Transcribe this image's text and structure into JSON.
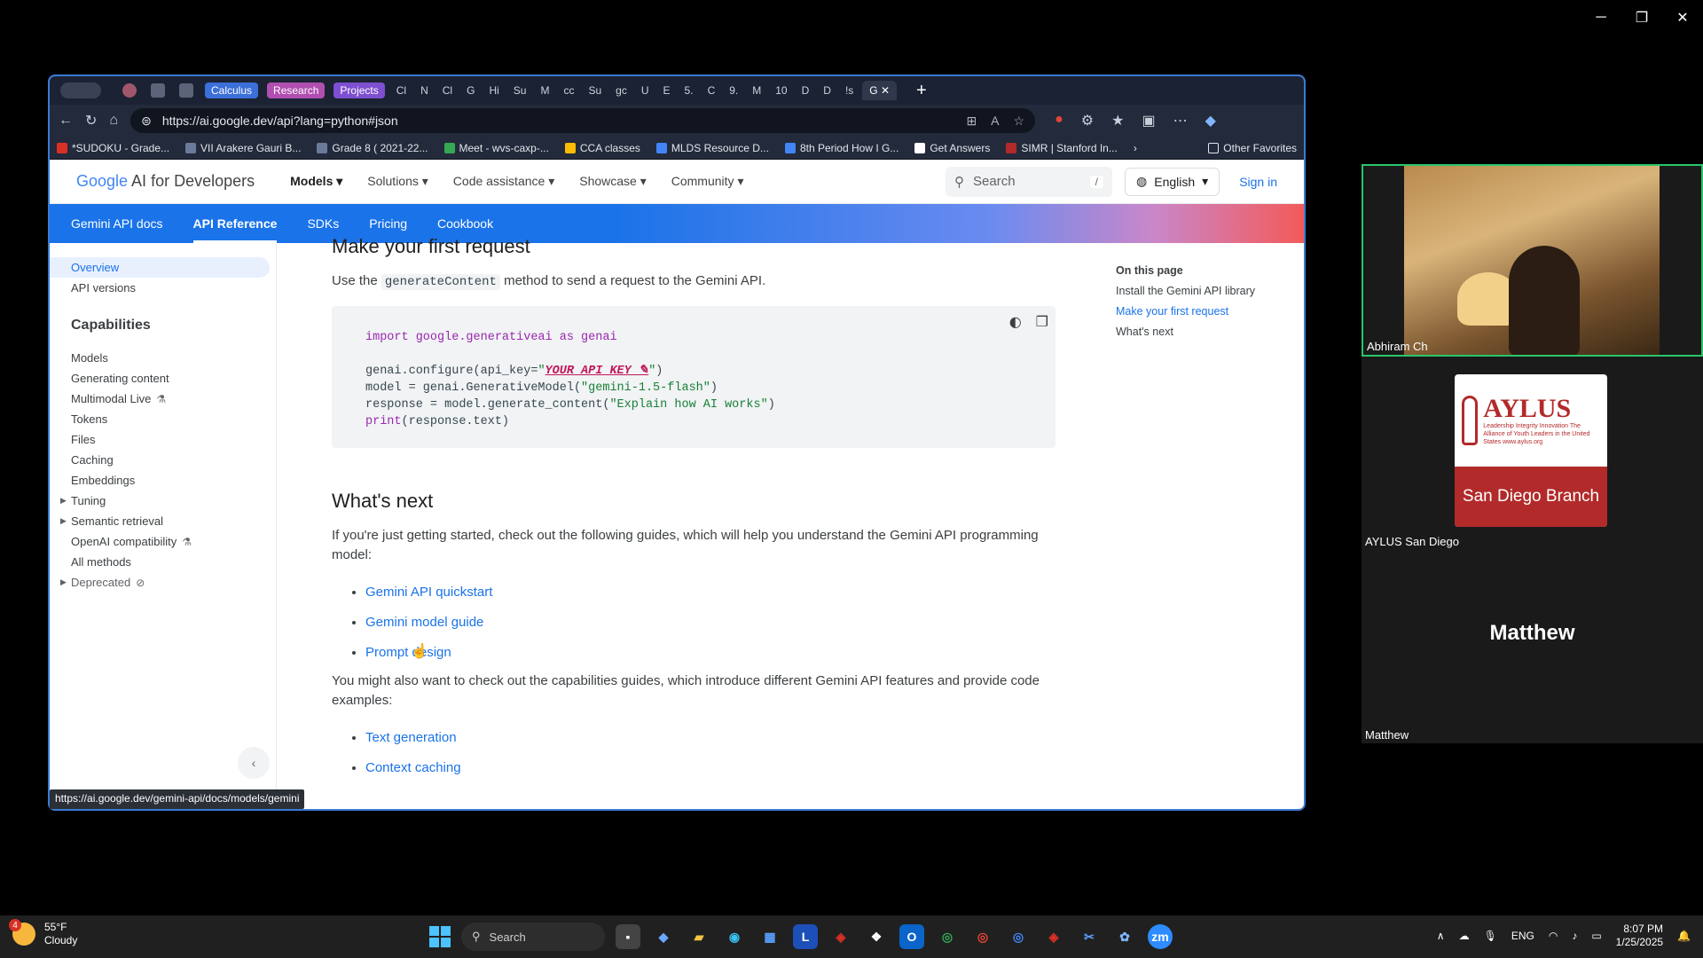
{
  "browser": {
    "tab_groups": [
      "Calculus",
      "Research",
      "Projects"
    ],
    "tabs": [
      "Cl",
      "N",
      "Cl",
      "G",
      "Hi",
      "Su",
      "M",
      "cc",
      "Su",
      "gc",
      "U",
      "E",
      "5.",
      "C",
      "9.",
      "M",
      "10",
      "D",
      "D",
      "!s",
      "G"
    ],
    "url": "https://ai.google.dev/api?lang=python#json",
    "bookmarks": [
      "*SUDOKU - Grade...",
      "VII Arakere Gauri B...",
      "Grade 8 ( 2021-22...",
      "Meet - wvs-caxp-...",
      "CCA classes",
      "MLDS Resource D...",
      "8th Period How I G...",
      "Get Answers",
      "SIMR | Stanford In..."
    ],
    "other_favorites": "Other Favorites",
    "status_url": "https://ai.google.dev/gemini-api/docs/models/gemini"
  },
  "site": {
    "logo_google": "Google",
    "logo_rest": " AI for Developers",
    "nav": [
      "Models",
      "Solutions",
      "Code assistance",
      "Showcase",
      "Community"
    ],
    "search_placeholder": "Search",
    "search_shortcut": "/",
    "language": "English",
    "sign_in": "Sign in",
    "subnav": [
      "Gemini API docs",
      "API Reference",
      "SDKs",
      "Pricing",
      "Cookbook"
    ]
  },
  "sidebar": {
    "top": [
      "Overview",
      "API versions"
    ],
    "heading": "Capabilities",
    "items": [
      "Models",
      "Generating content",
      "Multimodal Live",
      "Tokens",
      "Files",
      "Caching",
      "Embeddings",
      "Tuning",
      "Semantic retrieval",
      "OpenAI compatibility",
      "All methods",
      "Deprecated"
    ]
  },
  "article": {
    "h_first": "Make your first request",
    "use_pre": "Use the ",
    "use_code": "generateContent",
    "use_post": " method to send a request to the Gemini API.",
    "code": {
      "l1_kw": "import",
      "l1_mod": " google.generativeai ",
      "l1_as": "as",
      "l1_alias": " genai",
      "l3_pre": "genai.configure(api_key=",
      "l3_q1": "\"",
      "l3_key": "YOUR_API_KEY ✎",
      "l3_q2": "\"",
      "l3_post": ")",
      "l4_pre": "model = genai.GenerativeModel(",
      "l4_str": "\"gemini-1.5-flash\"",
      "l4_post": ")",
      "l5_pre": "response = model.generate_content(",
      "l5_str": "\"Explain how AI works\"",
      "l5_post": ")",
      "l6_kw": "print",
      "l6_post": "(response.text)"
    },
    "h_next": "What's next",
    "p_next": "If you're just getting started, check out the following guides, which will help you understand the Gemini API programming model:",
    "links1": [
      "Gemini API quickstart",
      "Gemini model guide",
      "Prompt design"
    ],
    "p_cap": "You might also want to check out the capabilities guides, which introduce different Gemini API features and provide code examples:",
    "links2": [
      "Text generation",
      "Context caching"
    ]
  },
  "toc": {
    "title": "On this page",
    "items": [
      "Install the Gemini API library",
      "Make your first request",
      "What's next"
    ]
  },
  "meeting": {
    "p1_name": "Abhiram Ch",
    "p2_name": "AYLUS San Diego",
    "p2_brand": "AYLUS",
    "p2_tag": "Leadership Integrity Innovation The Alliance of Youth Leaders in the United States www.aylus.org",
    "p2_branch": "San Diego Branch",
    "p3_big": "Matthew",
    "p3_name": "Matthew"
  },
  "taskbar": {
    "weather_temp": "55°F",
    "weather_desc": "Cloudy",
    "weather_badge": "4",
    "search": "Search",
    "lang": "ENG",
    "time": "8:07 PM",
    "date": "1/25/2025"
  }
}
